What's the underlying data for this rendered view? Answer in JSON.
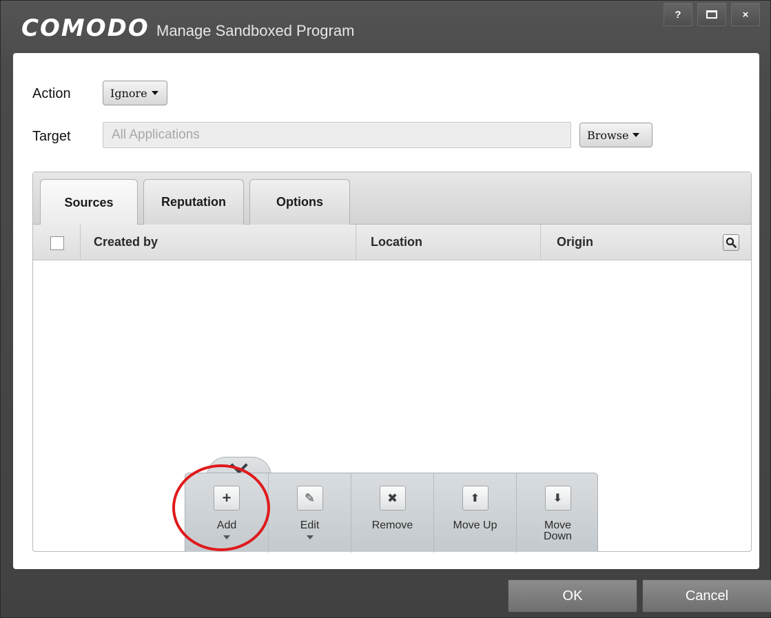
{
  "window": {
    "brand": "COMODO",
    "title": "Manage Sandboxed Program",
    "controls": {
      "help": "?",
      "close": "×"
    }
  },
  "form": {
    "action_label": "Action",
    "action_value": "Ignore",
    "target_label": "Target",
    "target_placeholder": "All Applications",
    "browse_label": "Browse"
  },
  "tabs": [
    {
      "label": "Sources",
      "active": true
    },
    {
      "label": "Reputation",
      "active": false
    },
    {
      "label": "Options",
      "active": false
    }
  ],
  "table": {
    "columns": [
      "Created by",
      "Location",
      "Origin"
    ],
    "rows": []
  },
  "toolbar": {
    "buttons": [
      {
        "label": "Add",
        "icon": "plus-icon",
        "glyph": "+"
      },
      {
        "label": "Edit",
        "icon": "pencil-icon",
        "glyph": "✎"
      },
      {
        "label": "Remove",
        "icon": "x-icon",
        "glyph": "✖"
      },
      {
        "label": "Move Up",
        "icon": "arrow-up-icon",
        "glyph": "⬆"
      },
      {
        "label": "Move Down",
        "icon": "arrow-down-icon",
        "glyph": "⬇"
      }
    ]
  },
  "footer": {
    "ok_label": "OK",
    "cancel_label": "Cancel"
  },
  "colors": {
    "window_bg": "#414141",
    "highlight": "#e0191c"
  }
}
